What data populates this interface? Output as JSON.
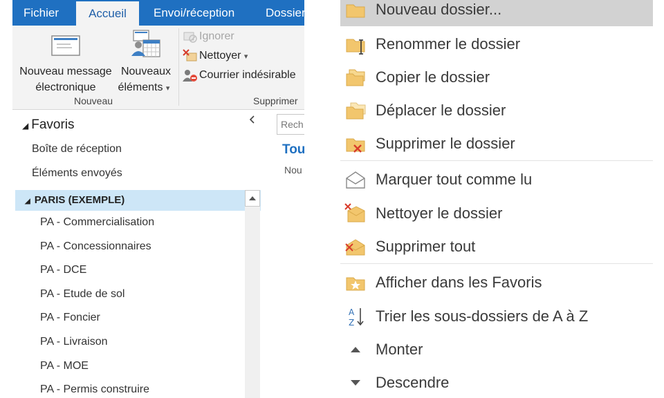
{
  "ribbon": {
    "tabs": [
      "Fichier",
      "Accueil",
      "Envoi/réception",
      "Dossier"
    ],
    "active_tab": "Accueil",
    "new_message": [
      "Nouveau message",
      "électronique"
    ],
    "new_items": [
      "Nouveaux",
      "éléments"
    ],
    "new_items_arrow": "▾",
    "group_nouveau": "Nouveau",
    "ignore": "Ignorer",
    "clean": "Nettoyer",
    "clean_arrow": "▾",
    "junk": "Courrier indésirable",
    "group_supprimer": "Supprimer"
  },
  "nav": {
    "favorites": "Favoris",
    "inbox": "Boîte de réception",
    "sent": "Éléments envoyés",
    "account": "PARIS (EXEMPLE)",
    "folders": [
      "PA - Commercialisation",
      "PA - Concessionnaires",
      "PA - DCE",
      "PA - Etude de sol",
      "PA - Foncier",
      "PA - Livraison",
      "PA - MOE",
      "PA - Permis construire"
    ]
  },
  "reading": {
    "search_placeholder": "Rech",
    "all_label": "Tou",
    "new_label": "Nou"
  },
  "context_menu": {
    "items": [
      {
        "label": "Nouveau dossier...",
        "icon": "new-folder-icon",
        "highlighted": true
      },
      {
        "label": "Renommer le dossier",
        "icon": "rename-folder-icon"
      },
      {
        "label": "Copier le dossier",
        "icon": "copy-folder-icon"
      },
      {
        "label": "Déplacer le dossier",
        "icon": "move-folder-icon"
      },
      {
        "label": "Supprimer le dossier",
        "icon": "delete-folder-icon"
      },
      {
        "label": "Marquer tout comme lu",
        "icon": "mark-read-icon"
      },
      {
        "label": "Nettoyer le dossier",
        "icon": "clean-folder-icon"
      },
      {
        "label": "Supprimer tout",
        "icon": "delete-all-icon"
      },
      {
        "label": "Afficher dans les Favoris",
        "icon": "favorites-icon"
      },
      {
        "label": "Trier les sous-dossiers de A à Z",
        "icon": "sort-az-icon"
      },
      {
        "label": "Monter",
        "icon": "move-up-icon"
      },
      {
        "label": "Descendre",
        "icon": "move-down-icon"
      }
    ]
  },
  "colors": {
    "tab_bar": "#1f70c1",
    "selection": "#cde6f7",
    "menu_highlight": "#d2d2d2",
    "folder": "#f2c66d"
  }
}
